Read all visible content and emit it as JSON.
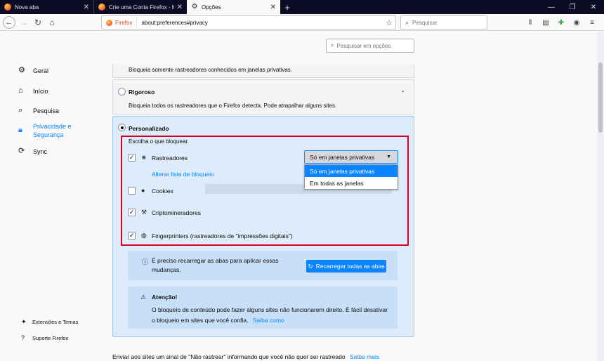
{
  "tabs": [
    {
      "title": "Nova aba",
      "close": "✕"
    },
    {
      "title": "Crie uma Conta Firefox - Mani",
      "close": "✕"
    },
    {
      "title": "Opções",
      "close": "✕"
    }
  ],
  "window_controls": {
    "minimize": "—",
    "maximize": "❐",
    "close": "✕"
  },
  "newtab": "+",
  "navbar": {
    "identity": "Firefox",
    "url": "about:preferences#privacy",
    "search_placeholder": "Pesquisar"
  },
  "sidebar": {
    "categories": [
      {
        "label": "Geral"
      },
      {
        "label": "Início"
      },
      {
        "label": "Pesquisa"
      },
      {
        "label": "Privacidade e Segurança"
      },
      {
        "label": "Sync"
      }
    ],
    "footer": [
      {
        "label": "Extensões e Temas"
      },
      {
        "label": "Suporte Firefox"
      }
    ]
  },
  "find_placeholder": "Pesquisar em opções",
  "standard": {
    "description": "Bloqueia somente rastreadores conhecidos em janelas privativas."
  },
  "strict": {
    "title": "Rigoroso",
    "description": "Bloqueia todos os rastreadores que o Firefox detecta. Pode atrapalhar alguns sites."
  },
  "custom": {
    "title": "Personalizado",
    "choose": "Escolha o que bloquear.",
    "items": [
      {
        "label": "Rastreadores",
        "checked": true
      },
      {
        "label": "Cookies",
        "checked": false
      },
      {
        "label": "Criptomineradores",
        "checked": true
      },
      {
        "label": "Fingerprinters (rastreadores de \"impressões digitais\")",
        "checked": true
      }
    ],
    "blocklist_link": "Alterar lista de bloqueio",
    "dropdown": {
      "selected": "Só em janelas privativas",
      "options": [
        "Só em janelas privativas",
        "Em todas as janelas"
      ]
    }
  },
  "reload": {
    "text": "É preciso recarregar as abas para aplicar essas mudanças.",
    "button": "Recarregar todas as abas"
  },
  "warning": {
    "title": "Atenção!",
    "text": "O bloqueio de conteúdo pode fazer alguns sites não funcionarem direito. É fácil desativar o bloqueio em sites que você confia.",
    "link": "Saiba como"
  },
  "dnt": {
    "text": "Enviar aos sites um sinal de \"Não rastrear\" informando que você não quer ser rastreado",
    "link": "Saiba mais"
  },
  "colors": {
    "accent": "#0a84ff",
    "highlight_box": "#d70022",
    "tabstrip": "#0c0c25"
  }
}
